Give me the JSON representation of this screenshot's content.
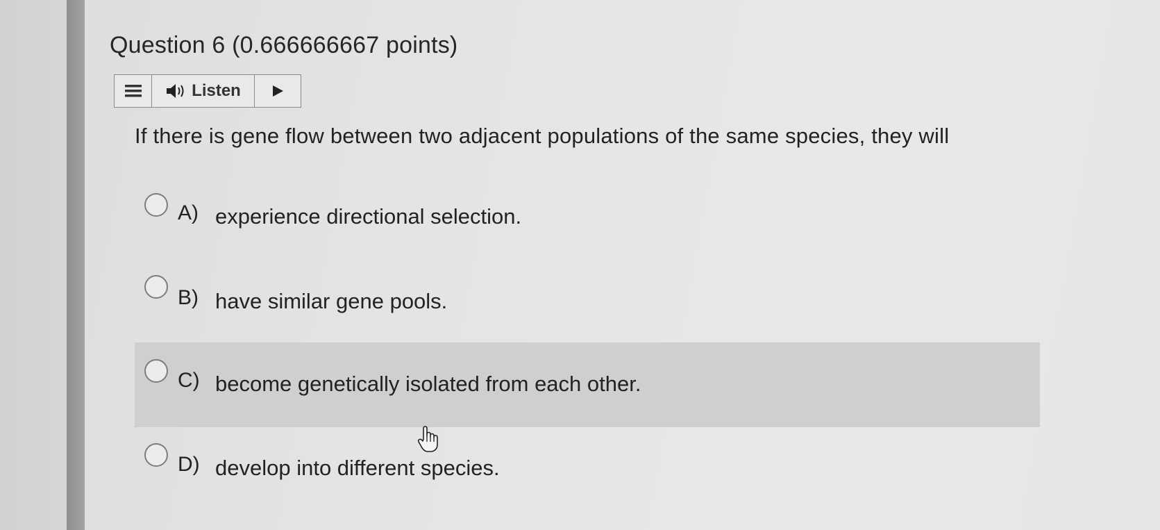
{
  "question": {
    "title": "Question 6 (0.666666667 points)",
    "prompt": "If there is gene flow between two adjacent populations of the same species, they will"
  },
  "toolbar": {
    "menu_icon": "hamburger-menu-icon",
    "listen_icon": "speaker-icon",
    "listen_label": "Listen",
    "play_icon": "play-icon"
  },
  "options": [
    {
      "letter": "A)",
      "text": "experience directional selection.",
      "selected": false,
      "hovered": false
    },
    {
      "letter": "B)",
      "text": "have similar gene pools.",
      "selected": false,
      "hovered": false
    },
    {
      "letter": "C)",
      "text": "become genetically isolated from each other.",
      "selected": false,
      "hovered": true
    },
    {
      "letter": "D)",
      "text": "develop into different species.",
      "selected": false,
      "hovered": false
    }
  ],
  "colors": {
    "hover_highlight": "#cfcfce",
    "text": "#222222",
    "border": "#8a8a8a"
  }
}
